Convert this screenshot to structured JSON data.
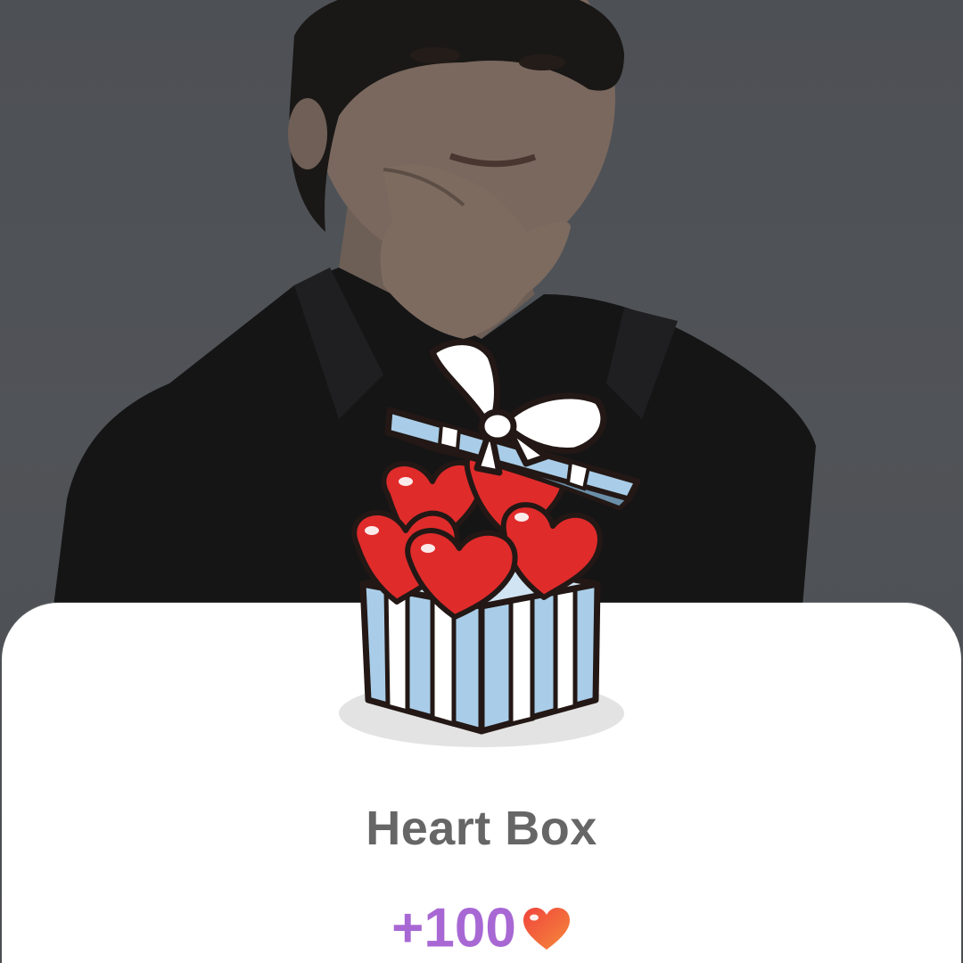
{
  "reward_card": {
    "title": "Heart Box",
    "amount": "+100"
  },
  "icons": {
    "gift_box": "heart-gift-box-icon",
    "reward_heart": "heart-icon"
  },
  "colors": {
    "backdrop": "#4d5055",
    "card": "#ffffff",
    "title_text": "#666666",
    "amount_text": "#a868d4",
    "box_blue": "#a9cde8",
    "heart_red": "#e02b2b"
  }
}
